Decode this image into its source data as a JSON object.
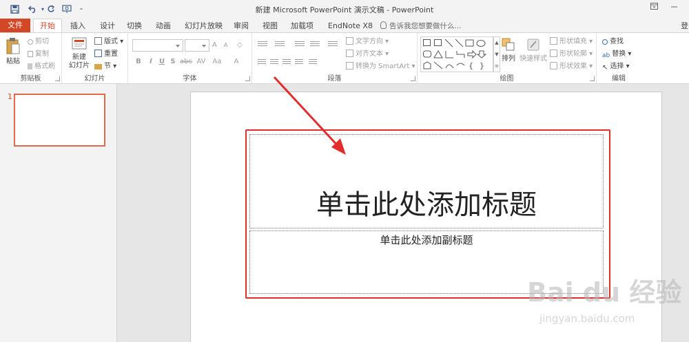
{
  "window": {
    "title": "新建 Microsoft PowerPoint 演示文稿 - PowerPoint",
    "signin": "登"
  },
  "tabs": {
    "file": "文件",
    "home": "开始",
    "items": [
      "插入",
      "设计",
      "切换",
      "动画",
      "幻灯片放映",
      "审阅",
      "视图",
      "加载项",
      "EndNote X8"
    ],
    "tell_me": "告诉我您想要做什么..."
  },
  "ribbon": {
    "clipboard": {
      "label": "剪贴板",
      "paste": "粘贴",
      "cut": "剪切",
      "copy": "复制",
      "format_painter": "格式刷"
    },
    "slides": {
      "label": "幻灯片",
      "new_slide_1": "新建",
      "new_slide_2": "幻灯片",
      "layout": "版式",
      "reset": "重置",
      "section": "节"
    },
    "font": {
      "label": "字体",
      "grow": "A",
      "shrink": "A",
      "bold": "B",
      "italic": "I",
      "underline": "U",
      "shadow": "S",
      "strike": "abc",
      "spacing": "AV",
      "case": "Aa",
      "color": "A"
    },
    "paragraph": {
      "label": "段落",
      "text_direction": "文字方向",
      "align_text": "对齐文本",
      "smartart": "转换为 SmartArt"
    },
    "drawing": {
      "label": "绘图",
      "arrange": "排列",
      "quick_styles": "快速样式",
      "fill": "形状填充",
      "outline": "形状轮廓",
      "effects": "形状效果"
    },
    "editing": {
      "label": "编辑",
      "find": "查找",
      "replace": "替换",
      "select": "选择"
    }
  },
  "thumbnail": {
    "number": "1"
  },
  "slide": {
    "title_placeholder": "单击此处添加标题",
    "subtitle_placeholder": "单击此处添加副标题"
  },
  "watermark": {
    "logo": "Bai du 经验",
    "url": "jingyan.baidu.com"
  },
  "colors": {
    "accent": "#d24726",
    "highlight": "#e32c2c"
  }
}
